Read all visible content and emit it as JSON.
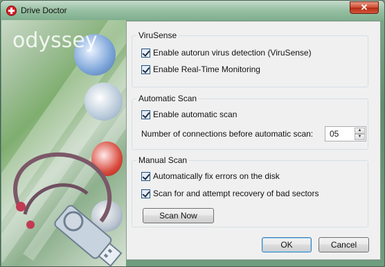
{
  "window": {
    "title": "Drive Doctor",
    "close_glyph": "✕",
    "icon": "red-cross-icon"
  },
  "branding": {
    "logo_text": "odyssey"
  },
  "virusense": {
    "legend": "ViruSense",
    "options": [
      {
        "label": "Enable autorun virus detection (ViruSense)",
        "checked": true
      },
      {
        "label": "Enable Real-Time Monitoring",
        "checked": true
      }
    ]
  },
  "automatic_scan": {
    "legend": "Automatic Scan",
    "enable_label": "Enable automatic scan",
    "enable_checked": true,
    "connections_label": "Number of connections before automatic scan:",
    "connections_value": "05",
    "spin_up": "▲",
    "spin_down": "▼"
  },
  "manual_scan": {
    "legend": "Manual Scan",
    "options": [
      {
        "label": "Automatically fix errors on the disk",
        "checked": true
      },
      {
        "label": "Scan for and attempt recovery of bad sectors",
        "checked": true
      }
    ],
    "scan_now_label": "Scan Now"
  },
  "footer": {
    "ok_label": "OK",
    "cancel_label": "Cancel"
  },
  "colors": {
    "accent": "#3c7fb1",
    "window_frame": "#6f9a7a",
    "close_red": "#c8402a"
  }
}
